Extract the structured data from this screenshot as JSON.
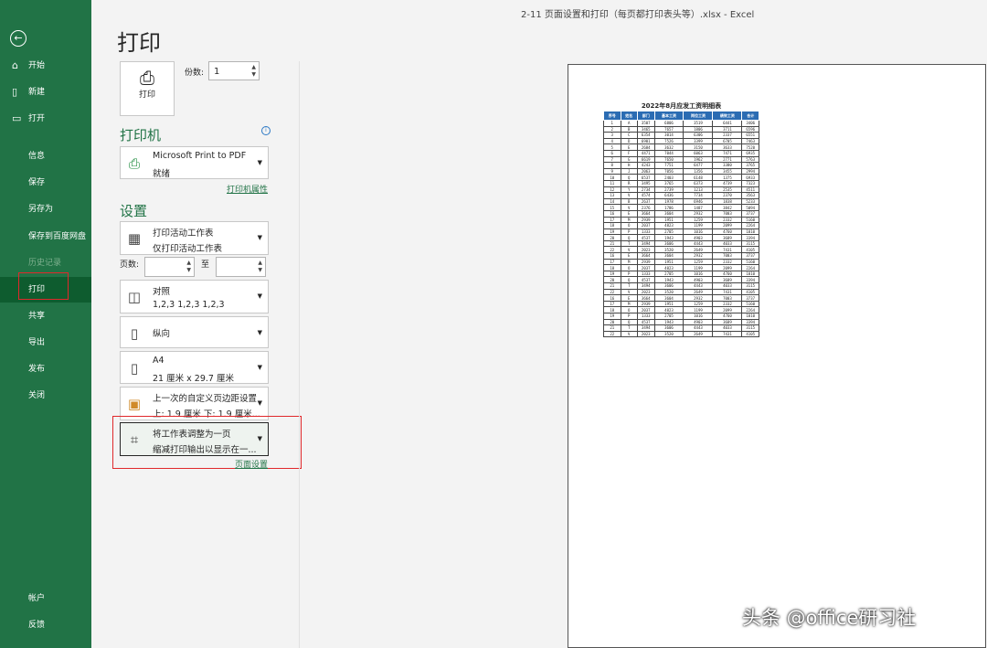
{
  "window": {
    "title": "2-11 页面设置和打印（每页都打印表头等）.xlsx  -  Excel"
  },
  "sidebar": {
    "back_icon": "back-arrow-icon",
    "items": [
      {
        "label": "开始",
        "icon": "home-icon"
      },
      {
        "label": "新建",
        "icon": "new-file-icon"
      },
      {
        "label": "打开",
        "icon": "folder-open-icon"
      },
      {
        "label": "信息"
      },
      {
        "label": "保存"
      },
      {
        "label": "另存为"
      },
      {
        "label": "保存到百度网盘"
      },
      {
        "label": "历史记录"
      },
      {
        "label": "打印"
      },
      {
        "label": "共享"
      },
      {
        "label": "导出"
      },
      {
        "label": "发布"
      },
      {
        "label": "关闭"
      }
    ],
    "bottom_items": [
      {
        "label": "帐户"
      },
      {
        "label": "反馈"
      }
    ]
  },
  "print": {
    "title": "打印",
    "print_button_label": "打印",
    "copies_label": "份数:",
    "copies_value": "1"
  },
  "printer": {
    "section_title": "打印机",
    "name": "Microsoft Print to PDF",
    "status": "就绪",
    "properties_link": "打印机属性"
  },
  "settings": {
    "section_title": "设置",
    "scope_line1": "打印活动工作表",
    "scope_line2": "仅打印活动工作表",
    "pages_label": "页数:",
    "to_label": "至",
    "collate_line1": "对照",
    "collate_line2": "1,2,3    1,2,3    1,2,3",
    "orientation": "纵向",
    "paper_line1": "A4",
    "paper_line2": "21 厘米 x 29.7 厘米",
    "margins_line1": "上一次的自定义页边距设置",
    "margins_line2": "上: 1.9 厘米 下: 1.9 厘米...",
    "scaling_line1": "将工作表调整为一页",
    "scaling_line2": "缩减打印输出以显示在一...",
    "page_setup_link": "页面设置"
  },
  "preview": {
    "sheet_title": "2022年8月应发工资明细表",
    "headers": [
      "序号",
      "姓名",
      "部门",
      "基本工资",
      "岗位工资",
      "绩效工资",
      "合计"
    ],
    "rows": [
      [
        "1",
        "A",
        "3507",
        "6806",
        "3519",
        "6441",
        "3406"
      ],
      [
        "2",
        "B",
        "3465",
        "7657",
        "1806",
        "3711",
        "6596"
      ],
      [
        "3",
        "C",
        "6354",
        "3014",
        "6306",
        "2337",
        "6551"
      ],
      [
        "4",
        "D",
        "6901",
        "7526",
        "3399",
        "6705",
        "7463"
      ],
      [
        "5",
        "E",
        "2684",
        "3632",
        "3150",
        "3633",
        "7520"
      ],
      [
        "6",
        "F",
        "4471",
        "7044",
        "6063",
        "7471",
        "6935"
      ],
      [
        "7",
        "G",
        "6619",
        "7650",
        "1962",
        "2771",
        "5763"
      ],
      [
        "8",
        "H",
        "4243",
        "7751",
        "6477",
        "3380",
        "3765"
      ],
      [
        "9",
        "J",
        "2063",
        "7056",
        "1356",
        "3455",
        "2994"
      ],
      [
        "10",
        "Q",
        "6537",
        "2403",
        "6148",
        "1375",
        "6933"
      ],
      [
        "11",
        "R",
        "3495",
        "3765",
        "6373",
        "4739",
        "7323"
      ],
      [
        "12",
        "Y",
        "2734",
        "2739",
        "1213",
        "2535",
        "4511"
      ],
      [
        "13",
        "V",
        "4574",
        "6436",
        "7734",
        "2370",
        "3563"
      ],
      [
        "14",
        "B",
        "2637",
        "1978",
        "6946",
        "1838",
        "5233"
      ],
      [
        "15",
        "V",
        "2376",
        "1786",
        "1487",
        "3842",
        "5094"
      ],
      [
        "16",
        "E",
        "3664",
        "3604",
        "2932",
        "7003",
        "3737"
      ],
      [
        "17",
        "M",
        "2939",
        "1951",
        "1259",
        "2332",
        "5160"
      ],
      [
        "18",
        "O",
        "2037",
        "4823",
        "1199",
        "2099",
        "2264"
      ],
      [
        "19",
        "P",
        "1333",
        "2705",
        "1016",
        "4760",
        "1010"
      ],
      [
        "20",
        "Q",
        "4537",
        "1943",
        "4903",
        "3689",
        "3394"
      ],
      [
        "21",
        "T",
        "3494",
        "3606",
        "4443",
        "4033",
        "3115"
      ],
      [
        "22",
        "V",
        "2023",
        "3520",
        "2649",
        "7431",
        "4105"
      ],
      [
        "16",
        "E",
        "3664",
        "3604",
        "2932",
        "7003",
        "3737"
      ],
      [
        "17",
        "M",
        "2939",
        "1951",
        "1259",
        "2332",
        "5160"
      ],
      [
        "18",
        "O",
        "2037",
        "4823",
        "1199",
        "2099",
        "2264"
      ],
      [
        "19",
        "P",
        "1333",
        "2705",
        "1016",
        "4760",
        "1010"
      ],
      [
        "20",
        "Q",
        "4537",
        "1943",
        "4903",
        "3689",
        "3394"
      ],
      [
        "21",
        "T",
        "3494",
        "3606",
        "4443",
        "4033",
        "3115"
      ],
      [
        "22",
        "V",
        "2023",
        "3520",
        "2649",
        "7431",
        "4105"
      ],
      [
        "16",
        "E",
        "3664",
        "3604",
        "2932",
        "7003",
        "3737"
      ],
      [
        "17",
        "M",
        "2939",
        "1951",
        "1259",
        "2332",
        "5160"
      ],
      [
        "18",
        "O",
        "2037",
        "4823",
        "1199",
        "2099",
        "2264"
      ],
      [
        "19",
        "P",
        "1333",
        "2705",
        "1016",
        "4760",
        "1010"
      ],
      [
        "20",
        "Q",
        "4537",
        "1943",
        "4903",
        "3689",
        "3394"
      ],
      [
        "21",
        "T",
        "3494",
        "3606",
        "4443",
        "4033",
        "3115"
      ],
      [
        "22",
        "V",
        "2023",
        "3520",
        "2649",
        "7431",
        "4105"
      ]
    ]
  },
  "watermark": "头条 @office研习社",
  "colors": {
    "accent": "#217346",
    "highlight": "#e0282b",
    "table_header": "#2b6cb3"
  }
}
